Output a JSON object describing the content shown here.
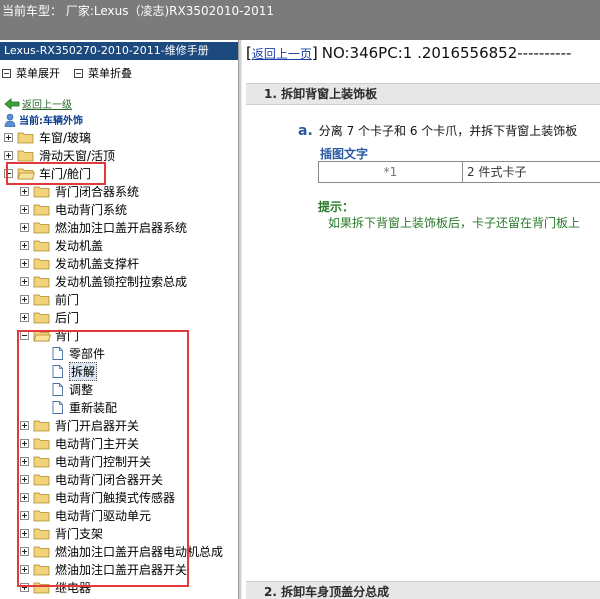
{
  "topbar": {
    "title": "当前车型：  厂家:Lexus（凌志)RX3502010-2011"
  },
  "left": {
    "manual_title": "Lexus-RX350270-2010-2011-维修手册",
    "menu": {
      "expand": "菜单展开",
      "collapse": "菜单折叠"
    },
    "back_label": "返回上一级",
    "current_label": "当前:车辆外饰"
  },
  "tree": {
    "items": [
      {
        "label": "车窗/玻璃",
        "level": 0,
        "type": "folder",
        "toggle": "plus"
      },
      {
        "label": "滑动天窗/活顶",
        "level": 0,
        "type": "folder",
        "toggle": "plus"
      },
      {
        "label": "车门/舱门",
        "level": 0,
        "type": "folder",
        "toggle": "minus"
      },
      {
        "label": "背门闭合器系统",
        "level": 1,
        "type": "folder",
        "toggle": "plus"
      },
      {
        "label": "电动背门系统",
        "level": 1,
        "type": "folder",
        "toggle": "plus"
      },
      {
        "label": "燃油加注口盖开启器系统",
        "level": 1,
        "type": "folder",
        "toggle": "plus"
      },
      {
        "label": "发动机盖",
        "level": 1,
        "type": "folder",
        "toggle": "plus"
      },
      {
        "label": "发动机盖支撑杆",
        "level": 1,
        "type": "folder",
        "toggle": "plus"
      },
      {
        "label": "发动机盖锁控制拉索总成",
        "level": 1,
        "type": "folder",
        "toggle": "plus"
      },
      {
        "label": "前门",
        "level": 1,
        "type": "folder",
        "toggle": "plus"
      },
      {
        "label": "后门",
        "level": 1,
        "type": "folder",
        "toggle": "plus"
      },
      {
        "label": "背门",
        "level": 1,
        "type": "folder",
        "toggle": "minus"
      },
      {
        "label": "零部件",
        "level": 2,
        "type": "doc"
      },
      {
        "label": "拆解",
        "level": 2,
        "type": "doc",
        "selected": true
      },
      {
        "label": "调整",
        "level": 2,
        "type": "doc"
      },
      {
        "label": "重新装配",
        "level": 2,
        "type": "doc"
      },
      {
        "label": "背门开启器开关",
        "level": 1,
        "type": "folder",
        "toggle": "plus"
      },
      {
        "label": "电动背门主开关",
        "level": 1,
        "type": "folder",
        "toggle": "plus"
      },
      {
        "label": "电动背门控制开关",
        "level": 1,
        "type": "folder",
        "toggle": "plus"
      },
      {
        "label": "电动背门闭合器开关",
        "level": 1,
        "type": "folder",
        "toggle": "plus"
      },
      {
        "label": "电动背门触摸式传感器",
        "level": 1,
        "type": "folder",
        "toggle": "plus"
      },
      {
        "label": "电动背门驱动单元",
        "level": 1,
        "type": "folder",
        "toggle": "plus"
      },
      {
        "label": "背门支架",
        "level": 1,
        "type": "folder",
        "toggle": "plus"
      },
      {
        "label": "燃油加注口盖开启器电动机总成",
        "level": 1,
        "type": "folder",
        "toggle": "plus"
      },
      {
        "label": "燃油加注口盖开启器开关",
        "level": 1,
        "type": "folder",
        "toggle": "plus"
      },
      {
        "label": "继电器",
        "level": 1,
        "type": "folder",
        "toggle": "plus"
      }
    ]
  },
  "content": {
    "bracket_open": "[",
    "back_link": "返回上一页",
    "bracket_close": "]",
    "doc_no": "NO:346PC:1 .2016556852----------",
    "section1": "1. 拆卸背窗上装饰板",
    "step_letter": "a.",
    "step_text": "分离 7 个卡子和 6 个卡爪，并拆下背窗上装饰板",
    "illus_title": "插图文字",
    "illus_row": {
      "key": "*1",
      "value": "2 件式卡子"
    },
    "hint_label": "提示：",
    "hint_text": "如果拆下背窗上装饰板后，卡子还留在背门板上",
    "section2": "2. 拆卸车身顶盖分总成"
  },
  "colors": {
    "topbar": "#7b7b7b",
    "manual_title_bg": "#1c4a7e",
    "section_bg": "#e7e7e7",
    "link": "#1b3fa8",
    "hint": "#2a7a2a",
    "step_accent": "#2b5aa0",
    "highlight_box": "#e23a3a",
    "folder": "#f2d37a"
  }
}
